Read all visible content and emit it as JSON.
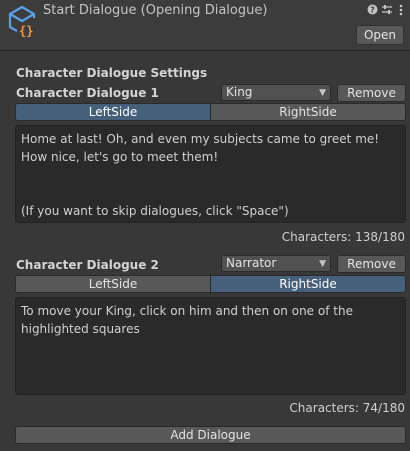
{
  "header": {
    "title": "Start Dialogue (Opening Dialogue)",
    "open_label": "Open",
    "icons": [
      "asset-script-icon",
      "help-icon",
      "preset-sliders-icon",
      "more-menu-icon"
    ]
  },
  "section_title": "Character Dialogue Settings",
  "dialogues": [
    {
      "label": "Character Dialogue 1",
      "character": "King",
      "remove_label": "Remove",
      "side_left": "LeftSide",
      "side_right": "RightSide",
      "selected_side": "LeftSide",
      "text": "Home at last! Oh, and even my subjects came to greet me! How nice, let's go to meet them!\n\n\n(If you want to skip dialogues, click \"Space\")",
      "counter": "Characters: 138/180"
    },
    {
      "label": "Character Dialogue 2",
      "character": "Narrator",
      "remove_label": "Remove",
      "side_left": "LeftSide",
      "side_right": "RightSide",
      "selected_side": "RightSide",
      "text": "To move your King, click on him and then on one of the highlighted squares",
      "counter": "Characters: 74/180"
    }
  ],
  "add_label": "Add Dialogue",
  "colors": {
    "background": "#383838",
    "selected_toggle": "#46607c",
    "icon_blue": "#5aa0ea",
    "icon_orange": "#f29a35"
  }
}
